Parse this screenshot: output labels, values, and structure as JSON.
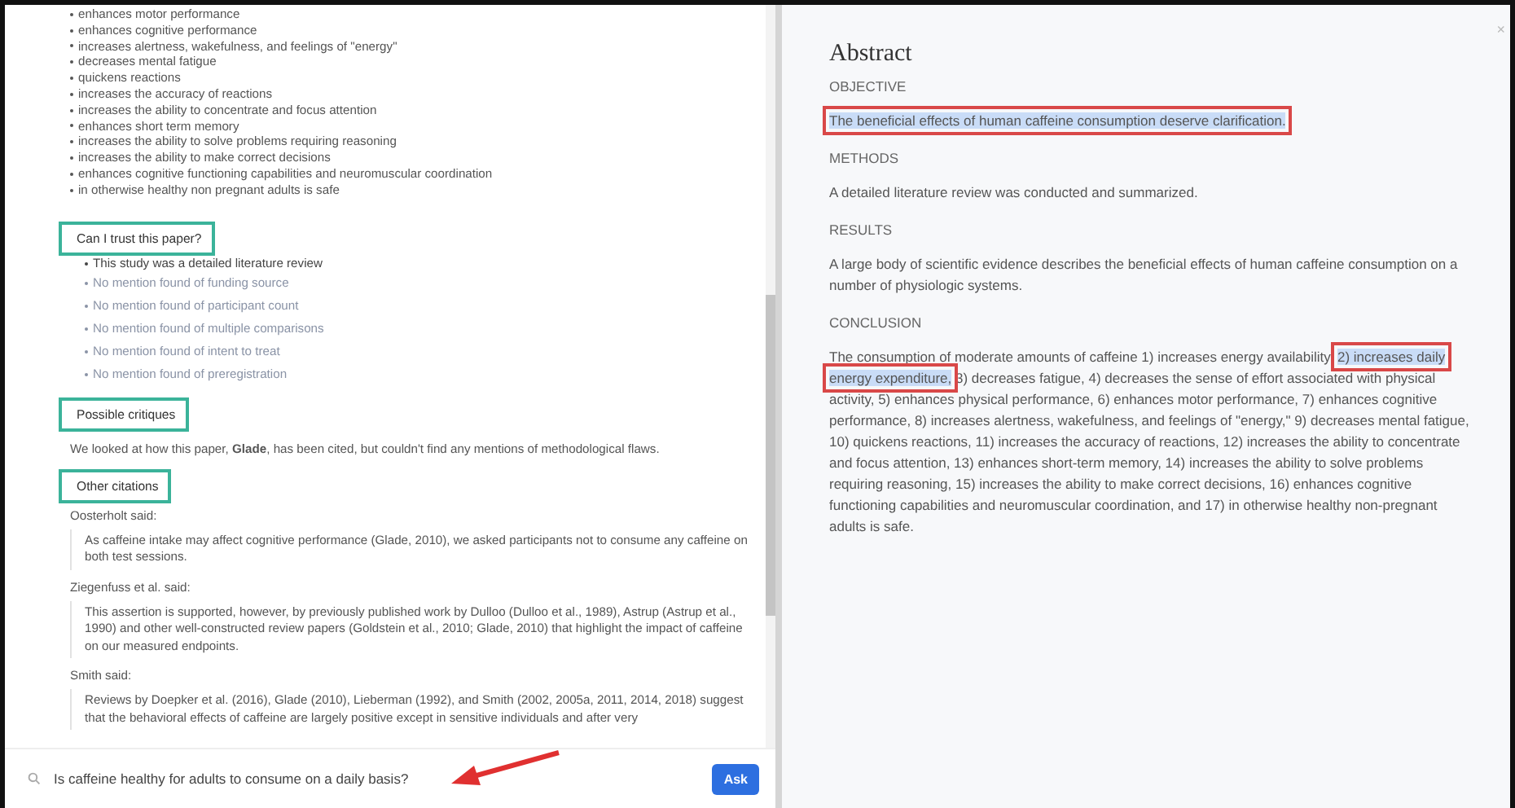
{
  "findings": [
    "enhances motor performance",
    "enhances cognitive performance",
    "increases alertness, wakefulness, and feelings of \"energy\"",
    "decreases mental fatigue",
    "quickens reactions",
    "increases the accuracy of reactions",
    "increases the ability to concentrate and focus attention",
    "enhances short term memory",
    "increases the ability to solve problems requiring reasoning",
    "increases the ability to make correct decisions",
    "enhances cognitive functioning capabilities and neuromuscular coordination",
    "in otherwise healthy non pregnant adults is safe"
  ],
  "trust": {
    "heading": "Can I trust this paper?",
    "items": [
      {
        "text": "This study was a detailed literature review",
        "found": true
      },
      {
        "text": "No mention found of funding source",
        "found": false
      },
      {
        "text": "No mention found of participant count",
        "found": false
      },
      {
        "text": "No mention found of multiple comparisons",
        "found": false
      },
      {
        "text": "No mention found of intent to treat",
        "found": false
      },
      {
        "text": "No mention found of preregistration",
        "found": false
      }
    ]
  },
  "critiques": {
    "heading": "Possible critiques",
    "text": "We looked at how this paper, **Glade**, has been cited, but couldn't find any mentions of methodological flaws."
  },
  "citations": {
    "heading": "Other citations",
    "items": [
      {
        "author": "Oosterholt said:",
        "quote": "As caffeine intake may affect cognitive performance (Glade, 2010), we asked participants not to consume any caffeine on both test sessions."
      },
      {
        "author": "Ziegenfuss et al. said:",
        "quote": "This assertion is supported, however, by previously published work by Dulloo (Dulloo et al., 1989), Astrup (Astrup et al., 1990) and other well-constructed review papers (Goldstein et al., 2010; Glade, 2010) that highlight the impact of caffeine on our measured endpoints."
      },
      {
        "author": "Smith said:",
        "quote": "Reviews by Doepker et al. (2016), Glade (2010), Lieberman (1992), and Smith (2002, 2005a, 2011, 2014, 2018) suggest that the behavioral effects of caffeine are largely positive except in sensitive individuals and after very"
      }
    ]
  },
  "question": {
    "value": "Is caffeine healthy for adults to consume on a daily basis?",
    "button": "Ask"
  },
  "abstract": {
    "title": "Abstract",
    "close": "×",
    "sections": [
      {
        "heading": "OBJECTIVE",
        "parts": [
          {
            "text": "The beneficial effects of human caffeine consumption deserve clarification.",
            "highlighted": true
          }
        ]
      },
      {
        "heading": "METHODS",
        "parts": [
          {
            "text": "A detailed literature review was conducted and summarized.",
            "highlighted": false
          }
        ]
      },
      {
        "heading": "RESULTS",
        "parts": [
          {
            "text": "A large body of scientific evidence describes the beneficial effects of human caffeine consumption on a number of physiologic systems.",
            "highlighted": false
          }
        ]
      },
      {
        "heading": "CONCLUSION",
        "parts": [
          {
            "text": "The consumption of moderate amounts of caffeine 1) increases energy availability, ",
            "highlighted": false
          },
          {
            "text": "2) increases daily energy expenditure,",
            "highlighted": true
          },
          {
            "text": " 3) decreases fatigue, 4) decreases the sense of effort associated with physical activity, 5) enhances physical performance, 6) enhances motor performance, 7) enhances cognitive performance, 8) increases alertness, wakefulness, and feelings of \"energy,\" 9) decreases mental fatigue, 10) quickens reactions, 11) increases the accuracy of reactions, 12) increases the ability to concentrate and focus attention, 13) enhances short-term memory, 14) increases the ability to solve problems requiring reasoning, 15) increases the ability to make correct decisions, 16) enhances cognitive functioning capabilities and neuromuscular coordination, and 17) in otherwise healthy non-pregnant adults is safe.",
            "highlighted": false
          }
        ]
      }
    ]
  }
}
